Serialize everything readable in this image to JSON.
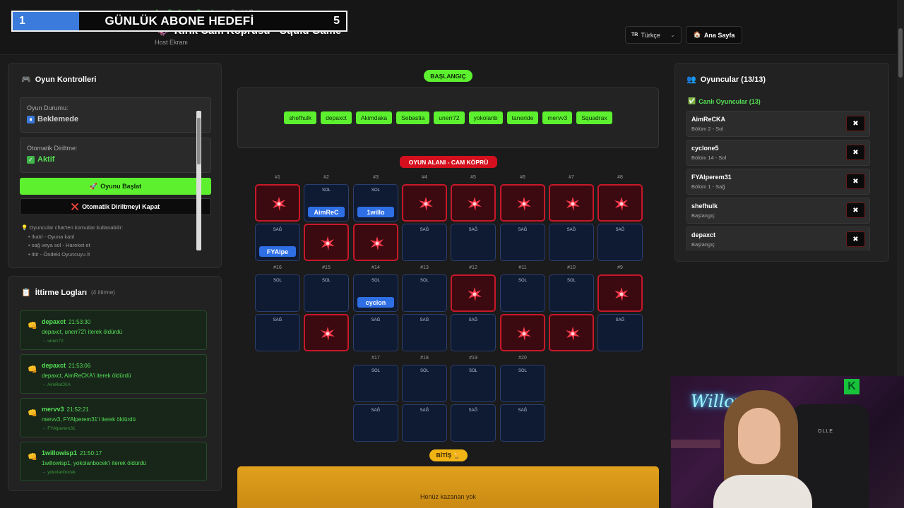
{
  "header": {
    "breadcrumbs": [
      "Ana Sayfa",
      ">",
      "Oyunlar",
      ">",
      "Squid Game"
    ],
    "title": "Kırık Cam Köprüsü - Squid Game",
    "title_icon": "🦑",
    "subtitle": "Host Ekranı",
    "language": "Türkçe",
    "language_flag": "TR",
    "home_button": "Ana Sayfa",
    "home_icon": "🏠"
  },
  "goal_overlay": {
    "current": "1",
    "title": "GÜNLÜK ABONE HEDEFİ",
    "target": "5",
    "progress_fraction": 0.2,
    "fill_color": "#3b7bdc"
  },
  "controls": {
    "title": "Oyun Kontrolleri",
    "title_icon": "🎮",
    "status_label": "Oyun Durumu:",
    "status_value": "Beklemede",
    "revive_label": "Otomatik Diriltme:",
    "revive_value": "Aktif",
    "start_button": "Oyunu Başlat",
    "start_icon": "🚀",
    "revive_button": "Otomatik Diriltmeyi Kapat",
    "revive_icon": "❌",
    "hint_title": "Oyuncular chat'ten komutlar kullanabilir:",
    "hint_icon": "💡",
    "hints": [
      "• !katıl - Oyuna katıl",
      "• sağ veya sol - Hareket et",
      "• ittir - Öndeki Oyuncuyu İt"
    ]
  },
  "logs": {
    "title": "İttirme Logları",
    "title_icon": "📋",
    "count": "(4 ittirme)",
    "entries": [
      {
        "who": "depaxct",
        "time": "21:53:30",
        "msg": "depaxct, unerr72'i iterek öldürdü",
        "target": "→ unerr72"
      },
      {
        "who": "depaxct",
        "time": "21:53:06",
        "msg": "depaxct, AimReCKA'i iterek öldürdü",
        "target": "→ AimReCKA"
      },
      {
        "who": "mervv3",
        "time": "21:52:21",
        "msg": "mervv3, FYAlperem31'i iterek öldürdü",
        "target": "→ FYAlperem31"
      },
      {
        "who": "1willowisp1",
        "time": "21:50:17",
        "msg": "1willowisp1, yokolanbocek'i iterek öldürdü",
        "target": "→ yokolanbocek"
      }
    ]
  },
  "board": {
    "start_label": "BAŞLANGIÇ",
    "start_players": [
      "shefhulk",
      "depaxct",
      "Akimdaka",
      "Sebastia",
      "unerr72",
      "yokolanb",
      "taneride",
      "mervv3",
      "Squadrax"
    ],
    "area_label": "OYUN ALANI - CAM KÖPRÜ",
    "finish_label": "BİTİŞ 🏆",
    "finish_text": "Henüz kazanan yok",
    "side_left": "SOL",
    "side_right": "SAĞ",
    "rows": [
      {
        "cols": [
          {
            "num": "#1",
            "top": {
              "state": "broken"
            },
            "bottom": {
              "state": "safe",
              "player": "FYAlpe"
            }
          },
          {
            "num": "#2",
            "top": {
              "state": "safe",
              "player": "AimReC"
            },
            "bottom": {
              "state": "broken"
            }
          },
          {
            "num": "#3",
            "top": {
              "state": "safe",
              "player": "1willo"
            },
            "bottom": {
              "state": "broken"
            }
          },
          {
            "num": "#4",
            "top": {
              "state": "broken"
            },
            "bottom": {
              "state": "safe"
            }
          },
          {
            "num": "#5",
            "top": {
              "state": "broken"
            },
            "bottom": {
              "state": "safe"
            }
          },
          {
            "num": "#6",
            "top": {
              "state": "broken"
            },
            "bottom": {
              "state": "safe"
            }
          },
          {
            "num": "#7",
            "top": {
              "state": "broken"
            },
            "bottom": {
              "state": "safe"
            }
          },
          {
            "num": "#8",
            "top": {
              "state": "broken"
            },
            "bottom": {
              "state": "safe"
            }
          }
        ]
      },
      {
        "cols": [
          {
            "num": "#16",
            "top": {
              "state": "safe"
            },
            "bottom": {
              "state": "safe"
            }
          },
          {
            "num": "#15",
            "top": {
              "state": "safe"
            },
            "bottom": {
              "state": "broken"
            }
          },
          {
            "num": "#14",
            "top": {
              "state": "safe",
              "player": "cyclon"
            },
            "bottom": {
              "state": "safe"
            }
          },
          {
            "num": "#13",
            "top": {
              "state": "safe"
            },
            "bottom": {
              "state": "safe"
            }
          },
          {
            "num": "#12",
            "top": {
              "state": "broken"
            },
            "bottom": {
              "state": "safe"
            }
          },
          {
            "num": "#11",
            "top": {
              "state": "safe"
            },
            "bottom": {
              "state": "broken"
            }
          },
          {
            "num": "#10",
            "top": {
              "state": "safe"
            },
            "bottom": {
              "state": "broken"
            }
          },
          {
            "num": "#9",
            "top": {
              "state": "broken"
            },
            "bottom": {
              "state": "safe"
            }
          }
        ]
      },
      {
        "cols": [
          {
            "num": "#17",
            "top": {
              "state": "safe"
            },
            "bottom": {
              "state": "safe"
            }
          },
          {
            "num": "#18",
            "top": {
              "state": "safe"
            },
            "bottom": {
              "state": "safe"
            }
          },
          {
            "num": "#19",
            "top": {
              "state": "safe"
            },
            "bottom": {
              "state": "safe"
            }
          },
          {
            "num": "#20",
            "top": {
              "state": "safe"
            },
            "bottom": {
              "state": "safe"
            }
          }
        ]
      }
    ]
  },
  "players": {
    "title": "Oyuncular (13/13)",
    "title_icon": "👥",
    "alive_title": "Canlı Oyuncular (13)",
    "alive_icon": "✅",
    "list": [
      {
        "name": "AimReCKA",
        "status": "Bölüm 2 - Sol"
      },
      {
        "name": "cyclone5",
        "status": "Bölüm 14 - Sol"
      },
      {
        "name": "FYAlperem31",
        "status": "Bölüm 1 - Sağ"
      },
      {
        "name": "shefhulk",
        "status": "Başlangıç"
      },
      {
        "name": "depaxct",
        "status": "Başlangıç"
      }
    ],
    "kill_icon": "💀"
  },
  "webcam": {
    "neon_text": "Willowisp",
    "k_logo": "K",
    "chair_brand": "OLLE"
  },
  "colors": {
    "accent_green": "#5cf02f",
    "danger_red": "#c8182a",
    "safe_blue": "#0f1a33",
    "player_tag": "#2f6fe6",
    "finish_gold": "#e1a11c"
  }
}
